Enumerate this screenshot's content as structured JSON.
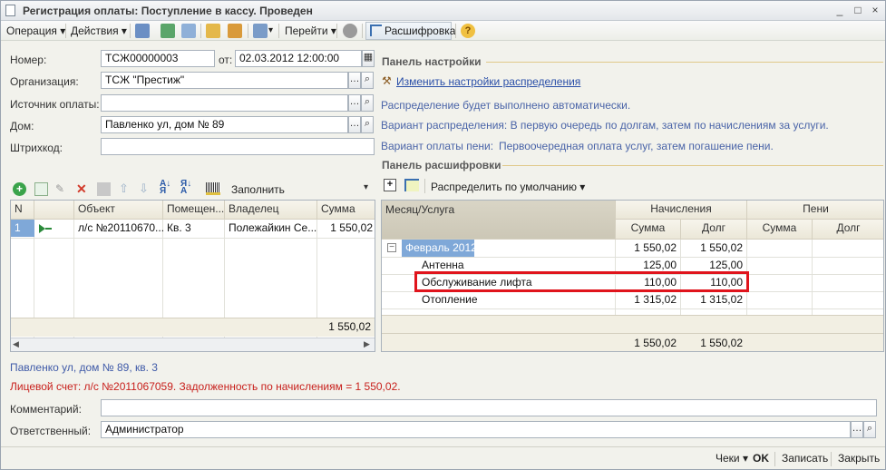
{
  "window": {
    "title": "Регистрация оплаты: Поступление в кассу. Проведен",
    "controls": [
      "_",
      "□",
      "×"
    ]
  },
  "toolbar": {
    "operation": "Операция",
    "actions": "Действия",
    "goto": "Перейти",
    "breakdown": "Расшифровка",
    "help": "?"
  },
  "form": {
    "number_label": "Номер:",
    "number_value": "ТСЖ00000003",
    "date_label": "от:",
    "date_value": "02.03.2012 12:00:00",
    "org_label": "Организация:",
    "org_value": "ТСЖ \"Престиж\"",
    "source_label": "Источник оплаты:",
    "source_value": "",
    "house_label": "Дом:",
    "house_value": "Павленко ул, дом № 89",
    "barcode_label": "Штрихкод:",
    "barcode_value": ""
  },
  "settings_panel": {
    "title": "Панель настройки",
    "change_link": "Изменить настройки распределения",
    "auto_text": "Распределение будет выполнено автоматически.",
    "variant_text": "Вариант распределения: В первую очередь по долгам, затем по начислениям за услуги.",
    "penalty_label": "Вариант оплаты пени:",
    "penalty_value": "Первоочередная оплата услуг, затем погашение пени."
  },
  "left_table": {
    "fill_label": "Заполнить",
    "headers": [
      "N",
      "",
      "Объект",
      "Помещен...",
      "Владелец",
      "Сумма"
    ],
    "rows": [
      {
        "n": "1",
        "object": "л/с №20110670...",
        "room": "Кв. 3",
        "owner": "Полежайкин Се...",
        "sum": "1 550,02"
      }
    ],
    "total": "1 550,02"
  },
  "breakdown_panel": {
    "title": "Панель расшифровки",
    "distribute_label": "Распределить по умолчанию",
    "headers": {
      "month": "Месяц/Услуга",
      "charges": "Начисления",
      "penalty": "Пени",
      "sum": "Сумма",
      "debt": "Долг"
    },
    "rows": [
      {
        "name": "Февраль 2012",
        "sum": "1 550,02",
        "debt": "1 550,02",
        "group": true
      },
      {
        "name": "Антенна",
        "sum": "125,00",
        "debt": "125,00"
      },
      {
        "name": "Обслуживание лифта",
        "sum": "110,00",
        "debt": "110,00",
        "highlight": true
      },
      {
        "name": "Отопление",
        "sum": "1 315,02",
        "debt": "1 315,02"
      }
    ],
    "total_sum": "1 550,02",
    "total_debt": "1 550,02"
  },
  "status": {
    "address": "Павленко ул, дом № 89, кв. 3",
    "account_debt": "Лицевой счет: л/с №2011067059. Задолженность по начислениям = 1 550,02."
  },
  "footer_fields": {
    "comment_label": "Комментарий:",
    "comment_value": "",
    "responsible_label": "Ответственный:",
    "responsible_value": "Администратор"
  },
  "bottom": {
    "checks": "Чеки",
    "ok": "OK",
    "save": "Записать",
    "close": "Закрыть"
  },
  "colors": {
    "highlight_border": "#e0141c",
    "selection_row": "#7fa8d8",
    "section_line": "#e0c98a",
    "info_text": "#4a64a8",
    "red_text": "#c8201c"
  }
}
